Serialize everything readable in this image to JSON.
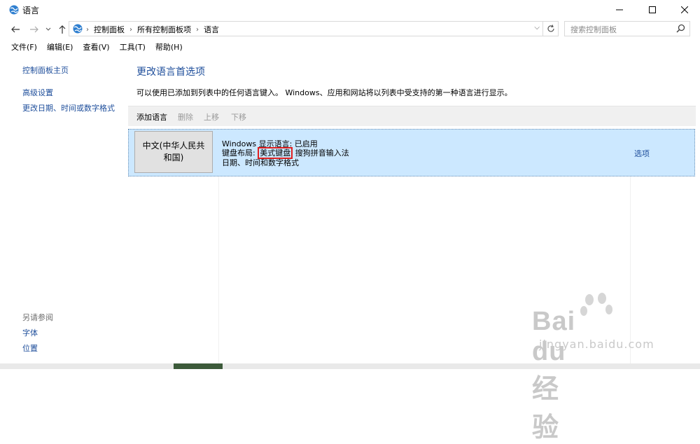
{
  "window": {
    "title": "语言"
  },
  "address": {
    "crumbs": [
      "控制面板",
      "所有控制面板项",
      "语言"
    ]
  },
  "search": {
    "placeholder": "搜索控制面板"
  },
  "menu": [
    "文件(F)",
    "编辑(E)",
    "查看(V)",
    "工具(T)",
    "帮助(H)"
  ],
  "sidebar": {
    "home": "控制面板主页",
    "links": [
      "高级设置",
      "更改日期、时间或数字格式"
    ],
    "see_also_label": "另请参阅",
    "see_also": [
      "字体",
      "位置"
    ]
  },
  "main": {
    "title": "更改语言首选项",
    "description": "可以使用已添加到列表中的任何语言键入。 Windows、应用和网站将以列表中受支持的第一种语言进行显示。",
    "toolbar": {
      "add": "添加语言",
      "remove": "删除",
      "up": "上移",
      "down": "下移"
    },
    "language": {
      "name": "中文(中华人民共和国)",
      "line1": "Windows 显示语言: 已启用",
      "line2_prefix": "键盘布局: ",
      "line2_highlight": "美式键盘",
      "line2_suffix": " 搜狗拼音输入法",
      "line3": "日期、时间和数字格式",
      "options": "选项"
    }
  },
  "watermark": {
    "logo": "Bai du 经验",
    "url": "jingyan.baidu.com"
  },
  "colors": {
    "link": "#1e4e9b",
    "selection": "#cce8ff",
    "highlight_box": "#e02020"
  }
}
